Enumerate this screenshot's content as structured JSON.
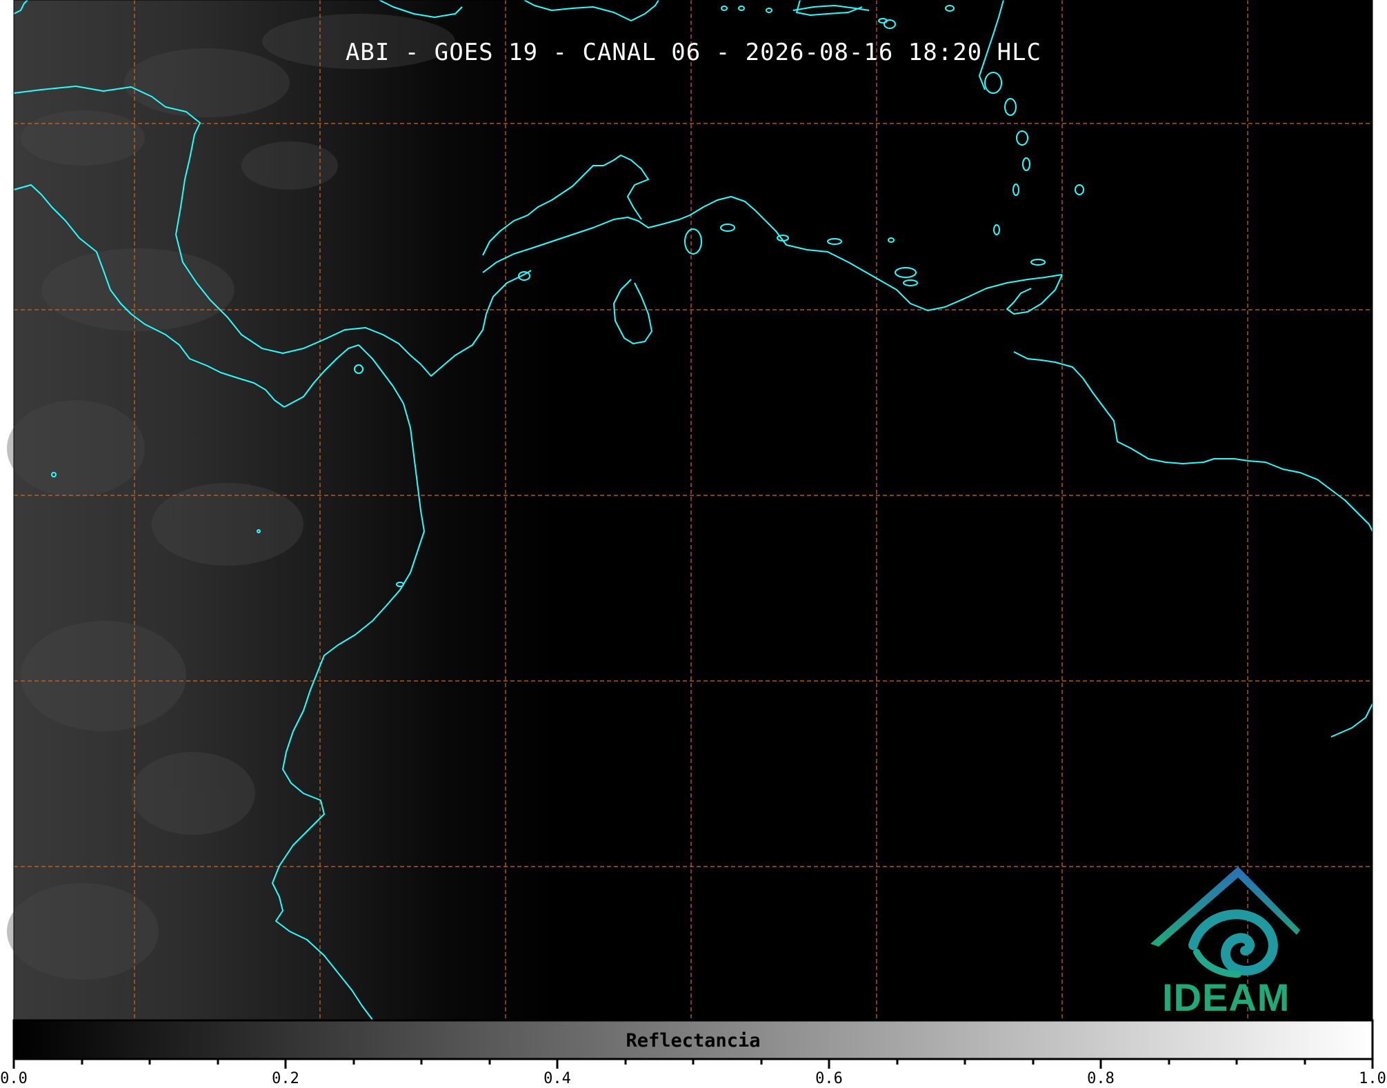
{
  "title": "ABI - GOES 19 - CANAL 06 - 2026-08-16 18:20 HLC",
  "colorbar": {
    "label": "Reflectancia",
    "ticks": [
      "0.0",
      "0.2",
      "0.4",
      "0.6",
      "0.8",
      "1.0"
    ],
    "range": [
      0.0,
      1.0
    ]
  },
  "logo": {
    "text": "IDEAM"
  },
  "colors": {
    "coastline": "#26ffff",
    "gridline": "#d2691e",
    "background": "#000000",
    "logo_green": "#1faa78",
    "logo_blue": "#2a6fb8"
  },
  "icons": [
    "ideam-logo-icon"
  ]
}
